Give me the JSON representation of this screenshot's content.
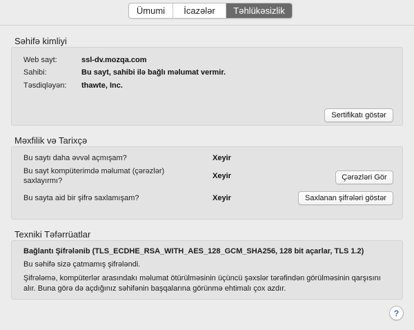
{
  "tabs": [
    {
      "label": "Ümumi",
      "active": false
    },
    {
      "label": "İcazələr",
      "active": false
    },
    {
      "label": "Təhlükəsizlik",
      "active": true
    }
  ],
  "identity": {
    "title": "Səhifə kimliyi",
    "website_label": "Web sayt:",
    "website_value": "ssl-dv.mozqa.com",
    "owner_label": "Sahibi:",
    "owner_value": "Bu sayt, sahibi ilə bağlı məlumat vermir.",
    "verified_label": "Təsdiqləyən:",
    "verified_value": "thawte, Inc.",
    "view_cert_button": "Sertifikatı göstər"
  },
  "privacy": {
    "title": "Məxfilik və Tarixçə",
    "q1_label": "Bu saytı daha əvvəl açmışam?",
    "q1_value": "Xeyir",
    "q2_label_line1": "Bu sayt kompüterimdə məlumat (çərəzlər)",
    "q2_label_line2": "saxlayırmı?",
    "q2_value": "Xeyir",
    "cookies_button": "Çərəzləri Gör",
    "q3_label": "Bu sayta aid bir şifrə saxlamışam?",
    "q3_value": "Xeyir",
    "passwords_button": "Saxlanan şifrələri göstər"
  },
  "technical": {
    "title": "Texniki Təfərrüatlar",
    "connection_line": "Bağlantı Şifrələnib (TLS_ECDHE_RSA_WITH_AES_128_GCM_SHA256, 128 bit açarlar, TLS 1.2)",
    "encrypted_line": "Bu səhifə sizə çatmamış şifrələndi.",
    "desc_line1": "Şifrələmə, kompüterlər arasındakı məlumat ötürülməsinin üçüncü şəxslər tərəfindən görülməsinin qarşısını",
    "desc_line2": "alır. Buna görə də açdığınız səhifənin başqalarına görünmə ehtimalı çox azdır."
  },
  "help": {
    "glyph": "?",
    "icon": "help-icon"
  },
  "colors": {
    "active_tab": "#6a6a6a",
    "help_glyph": "#3c6fd1"
  }
}
